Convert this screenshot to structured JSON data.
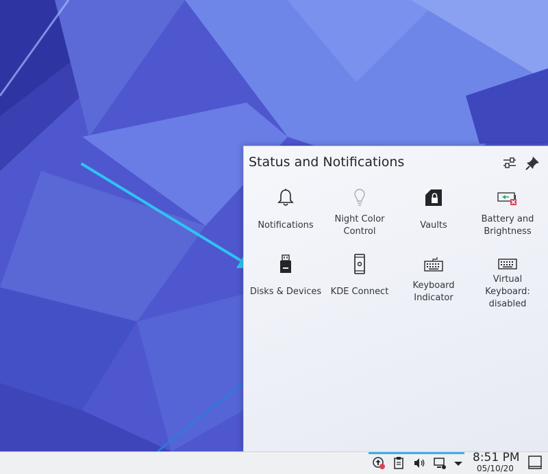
{
  "popup": {
    "title": "Status and Notifications",
    "configure_icon": "configure-icon",
    "pin_icon": "pin-icon"
  },
  "items": [
    {
      "label": "Notifications",
      "icon": "bell-icon"
    },
    {
      "label": "Night Color\nControl",
      "icon": "lightbulb-icon"
    },
    {
      "label": "Vaults",
      "icon": "vault-icon"
    },
    {
      "label": "Battery and\nBrightness",
      "icon": "battery-icon"
    },
    {
      "label": "Disks & Devices",
      "icon": "usb-drive-icon"
    },
    {
      "label": "KDE Connect",
      "icon": "phone-icon"
    },
    {
      "label": "Keyboard\nIndicator",
      "icon": "keyboard-icon"
    },
    {
      "label": "Virtual\nKeyboard:\ndisabled",
      "icon": "virtual-keyboard-icon"
    }
  ],
  "panel": {
    "time": "8:51 PM",
    "date": "05/10/20",
    "tray_icons": [
      "update-icon",
      "clipboard-icon",
      "volume-icon",
      "network-icon",
      "expand-arrow-icon"
    ],
    "show_desktop_icon": "show-desktop-icon"
  },
  "colors": {
    "accent": "#3daee9",
    "arrow": "#2ec4f2",
    "wallpaper": "#4a52c8"
  }
}
